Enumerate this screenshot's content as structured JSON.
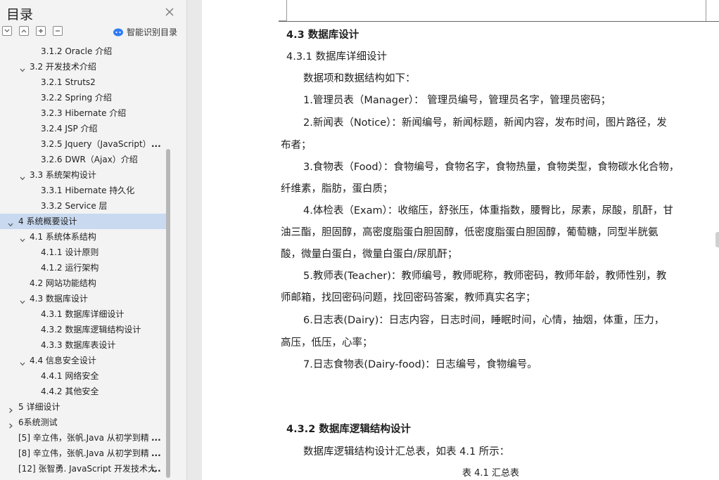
{
  "sidebar": {
    "title": "目录",
    "smart_label": "智能识别目录",
    "items": [
      {
        "label": "3.1.2 Oracle  介绍",
        "level": 3,
        "arrow": "none"
      },
      {
        "label": "3.2  开发技术介绍",
        "level": 2,
        "arrow": "down"
      },
      {
        "label": "3.2.1 Struts2",
        "level": 3,
        "arrow": "none"
      },
      {
        "label": "3.2.2 Spring  介绍",
        "level": 3,
        "arrow": "none"
      },
      {
        "label": "3.2.3 Hibernate  介绍",
        "level": 3,
        "arrow": "none"
      },
      {
        "label": "3.2.4 JSP  介绍",
        "level": 3,
        "arrow": "none"
      },
      {
        "label": "3.2.5 Jquery（JavaScript）",
        "level": 3,
        "arrow": "none",
        "more": "..."
      },
      {
        "label": "3.2.6 DWR（Ajax）介绍",
        "level": 3,
        "arrow": "none"
      },
      {
        "label": "3.3  系统架构设计",
        "level": 2,
        "arrow": "down"
      },
      {
        "label": "3.3.1 Hibernate 持久化",
        "level": 3,
        "arrow": "none"
      },
      {
        "label": "3.3.2 Service 层",
        "level": 3,
        "arrow": "none"
      },
      {
        "label": "4    系统概要设计",
        "level": 1,
        "arrow": "down",
        "active": true
      },
      {
        "label": "4.1  系统体系结构",
        "level": 2,
        "arrow": "down"
      },
      {
        "label": "4.1.1  设计原则",
        "level": 3,
        "arrow": "none"
      },
      {
        "label": "4.1.2  运行架构",
        "level": 3,
        "arrow": "none"
      },
      {
        "label": "4.2  网站功能结构",
        "level": 2,
        "arrow": "none"
      },
      {
        "label": "4.3  数据库设计",
        "level": 2,
        "arrow": "down"
      },
      {
        "label": "4.3.1  数据库详细设计",
        "level": 3,
        "arrow": "none"
      },
      {
        "label": "4.3.2  数据库逻辑结构设计",
        "level": 3,
        "arrow": "none"
      },
      {
        "label": "4.3.3  数据库表设计",
        "level": 3,
        "arrow": "none"
      },
      {
        "label": "4.4  信息安全设计",
        "level": 2,
        "arrow": "down"
      },
      {
        "label": "4.4.1  网络安全",
        "level": 3,
        "arrow": "none"
      },
      {
        "label": "4.4.2  其他安全",
        "level": 3,
        "arrow": "none"
      },
      {
        "label": "5    详细设计",
        "level": 1,
        "arrow": "right"
      },
      {
        "label": "6系统测试",
        "level": 1,
        "arrow": "right"
      },
      {
        "label": "[5]  辛立伟，张帆.Java 从初学到精",
        "level": 1,
        "arrow": "none",
        "more": "..."
      },
      {
        "label": "[8]  辛立伟，张帆.Java 从初学到精",
        "level": 1,
        "arrow": "none",
        "more": "..."
      },
      {
        "label": "[12]  张智勇. JavaScript 开发技术大",
        "level": 1,
        "arrow": "none",
        "more": "..."
      }
    ]
  },
  "document": {
    "h_4_3": "4.3  数据库设计",
    "h_4_3_1": "4.3.1  数据库详细设计",
    "intro": "数据项和数据结构如下：",
    "p1": "1.管理员表（Manager）： 管理员编号，管理员名字，管理员密码；",
    "p2a": "2.新闻表（Notice）：新闻编号，新闻标题，新闻内容，发布时间，图片路径，发",
    "p2b": "布者；",
    "p3a": "3.食物表（Food）：食物编号，食物名字，食物热量，食物类型，食物碳水化合物，",
    "p3b": "纤维素，脂肪，蛋白质；",
    "p4a": "4.体检表（Exam）：收缩压，舒张压，体重指数，腰臀比，尿素，尿酸，肌酐，甘",
    "p4b": "油三酯，胆固醇，高密度脂蛋白胆固醇，低密度脂蛋白胆固醇，葡萄糖，同型半胱氨",
    "p4c": "酸，微量白蛋白，微量白蛋白/尿肌酐；",
    "p5a": "5.教师表(Teacher)：教师编号，教师昵称，教师密码，教师年龄，教师性别，教",
    "p5b": "师邮箱，找回密码问题，找回密码答案，教师真实名字；",
    "p6a": "6.日志表(Dairy)：日志内容，日志时间，睡眠时间，心情，抽烟，体重，压力，",
    "p6b": "高压，低压，心率；",
    "p7": "7.日志食物表(Dairy-food)：日志编号，食物编号。",
    "h_4_3_2": "4.3.2  数据库逻辑结构设计",
    "p8": "数据库逻辑结构设计汇总表，如表 4.1 所示：",
    "caption": "表 4.1  汇总表"
  }
}
